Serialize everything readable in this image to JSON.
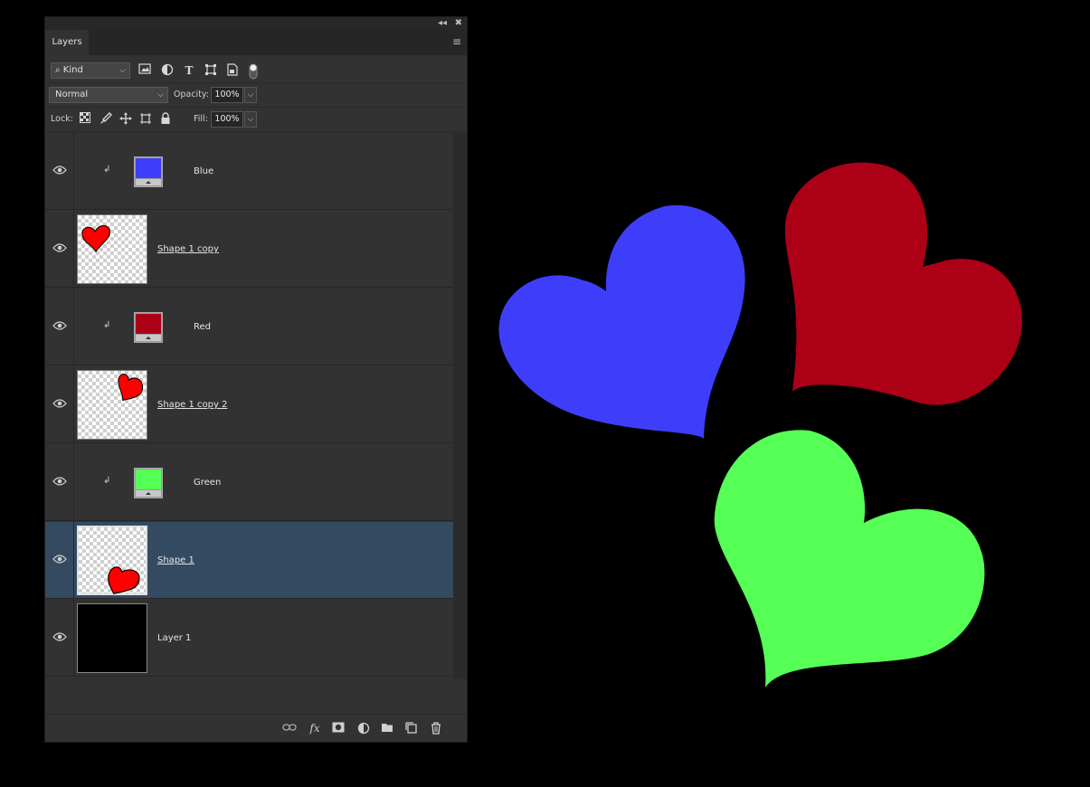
{
  "panel": {
    "tab_label": "Layers",
    "collapse_icon": "double-chevron-left-icon",
    "close_icon": "close-icon",
    "menu_icon": "hamburger-menu-icon"
  },
  "filter_bar": {
    "kind_label": "Kind",
    "icons": [
      "search-icon",
      "pixel-filter-icon",
      "adjustment-filter-icon",
      "type-filter-icon",
      "shape-filter-icon",
      "smart-object-filter-icon",
      "filter-toggle-icon"
    ]
  },
  "blend_bar": {
    "mode": "Normal",
    "opacity_label": "Opacity:",
    "opacity_value": "100%"
  },
  "lock_bar": {
    "lock_label": "Lock:",
    "fill_label": "Fill:",
    "fill_value": "100%"
  },
  "layers": [
    {
      "name": "Blue",
      "type": "fill",
      "color": "#3e3efa",
      "visible": true,
      "clipped": true,
      "selected": false
    },
    {
      "name": "Shape 1 copy",
      "type": "shape",
      "visible": true,
      "selected": false
    },
    {
      "name": "Red",
      "type": "fill",
      "color": "#ac0016",
      "visible": true,
      "clipped": true,
      "selected": false
    },
    {
      "name": "Shape 1 copy 2",
      "type": "shape",
      "visible": true,
      "selected": false
    },
    {
      "name": "Green",
      "type": "fill",
      "color": "#55ff55",
      "visible": true,
      "clipped": true,
      "selected": false
    },
    {
      "name": "Shape 1",
      "type": "shape",
      "visible": true,
      "selected": true
    },
    {
      "name": "Layer 1",
      "type": "pixel",
      "color": "#000000",
      "visible": true,
      "selected": false
    }
  ],
  "bottom_bar": {
    "icons": [
      "link-layers-icon",
      "fx-icon",
      "add-mask-icon",
      "new-adjustment-icon",
      "new-group-icon",
      "new-layer-icon",
      "delete-layer-icon"
    ]
  },
  "canvas": {
    "heart_colors": {
      "blue": "#3e3efa",
      "red": "#ac0016",
      "green": "#55ff55"
    }
  }
}
